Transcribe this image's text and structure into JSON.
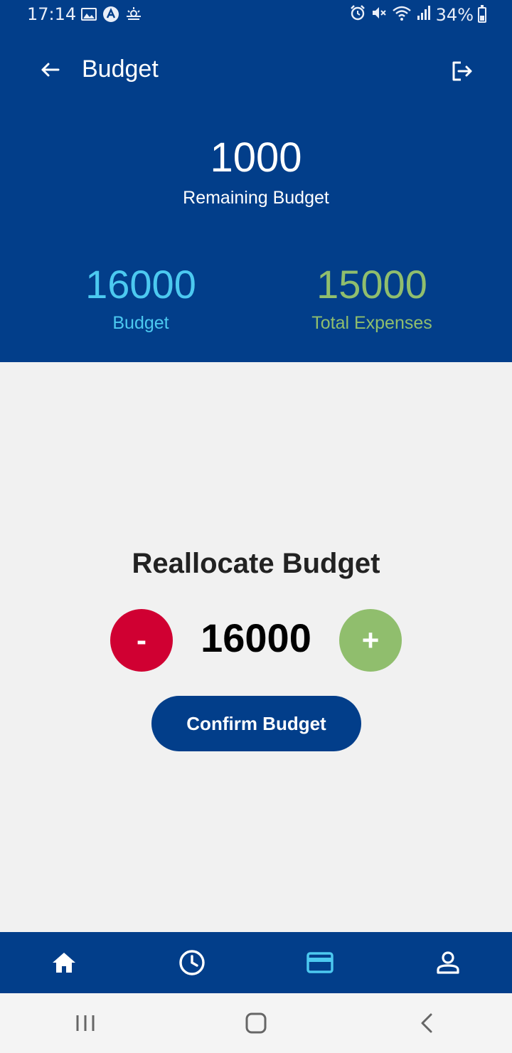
{
  "status_bar": {
    "time": "17:14",
    "battery": "34%",
    "left_icons": [
      "image-icon",
      "app-a-icon",
      "weather-icon"
    ],
    "right_icons": [
      "alarm-icon",
      "mute-icon",
      "wifi-icon",
      "signal-icon",
      "battery-icon"
    ]
  },
  "header": {
    "title": "Budget",
    "back_icon": "arrow-left-icon",
    "logout_icon": "logout-icon"
  },
  "summary": {
    "remaining_value": "1000",
    "remaining_label": "Remaining Budget",
    "budget_value": "16000",
    "budget_label": "Budget",
    "expenses_value": "15000",
    "expenses_label": "Total Expenses"
  },
  "reallocate": {
    "title": "Reallocate Budget",
    "minus_label": "-",
    "plus_label": "+",
    "amount": "16000",
    "confirm_label": "Confirm Budget"
  },
  "bottom_nav": {
    "items": [
      "home-icon",
      "clock-icon",
      "card-icon",
      "profile-icon"
    ],
    "active": "card-icon"
  },
  "colors": {
    "primary": "#023e8a",
    "budget": "#4cc9f0",
    "expenses": "#90be6d",
    "minus": "#d00032",
    "plus": "#90be6d",
    "background": "#f1f1f1"
  }
}
